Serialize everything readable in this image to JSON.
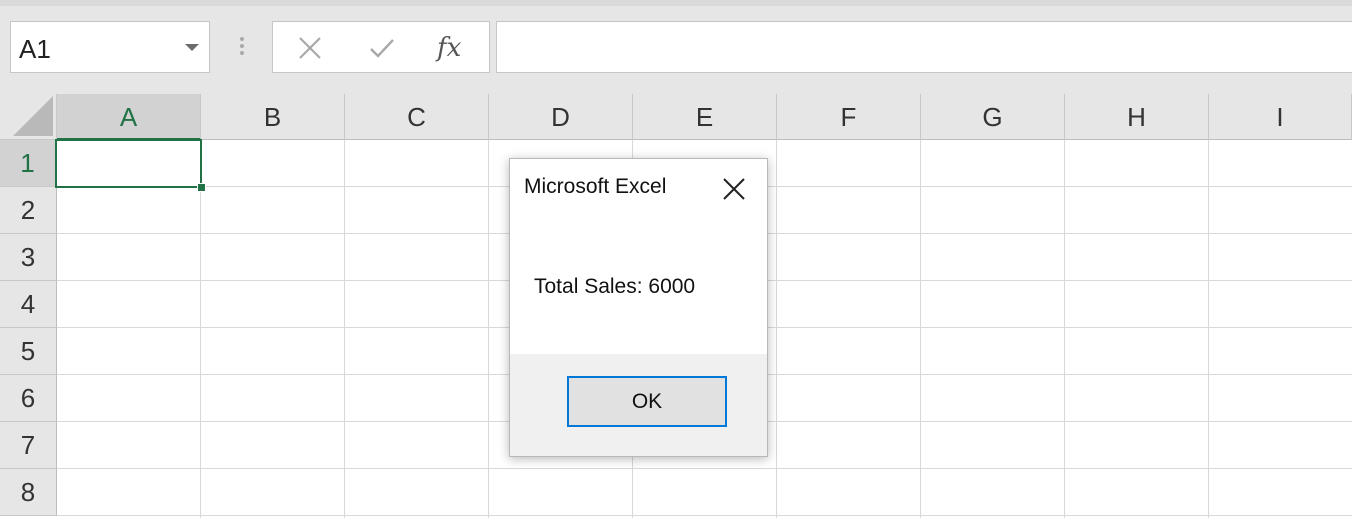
{
  "formula_bar": {
    "name_box": "A1",
    "cancel_icon": "close-x-icon",
    "enter_icon": "checkmark-icon",
    "fx_label": "fx",
    "formula_value": ""
  },
  "columns": [
    "A",
    "B",
    "C",
    "D",
    "E",
    "F",
    "G",
    "H",
    "I"
  ],
  "rows": [
    "1",
    "2",
    "3",
    "4",
    "5",
    "6",
    "7",
    "8"
  ],
  "selected_cell": "A1",
  "colors": {
    "accent": "#217346",
    "dialog_button_border": "#0078d7"
  },
  "dialog": {
    "title": "Microsoft Excel",
    "message": "Total Sales: 6000",
    "ok_label": "OK"
  }
}
